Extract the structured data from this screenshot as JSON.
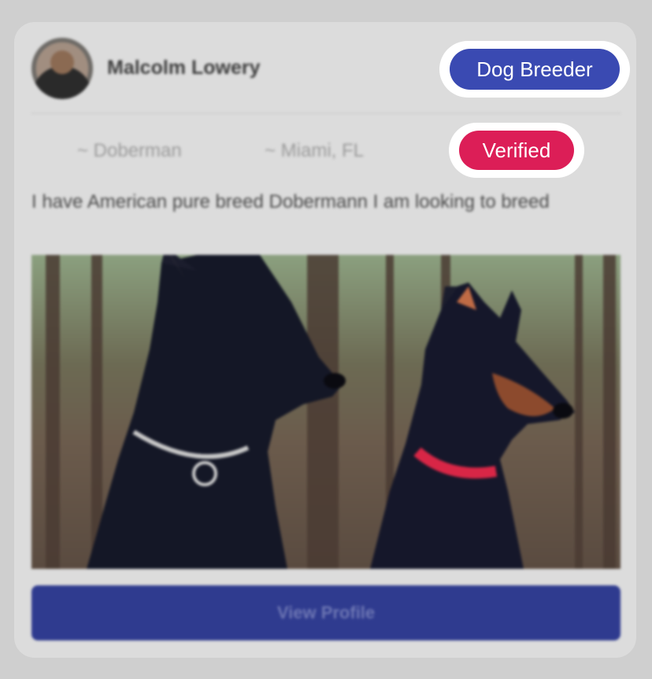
{
  "profile": {
    "name": "Malcolm Lowery",
    "role_badge": "Dog Breeder",
    "breed": "~ Doberman",
    "location": "~ Miami, FL",
    "status_badge": "Verified",
    "description": "I have American pure breed Dobermann I am looking to breed"
  },
  "actions": {
    "view_profile_label": "View Profile"
  },
  "colors": {
    "role_badge": "#3a4ab2",
    "status_badge": "#dc1e57",
    "button": "#2f3b8f"
  }
}
